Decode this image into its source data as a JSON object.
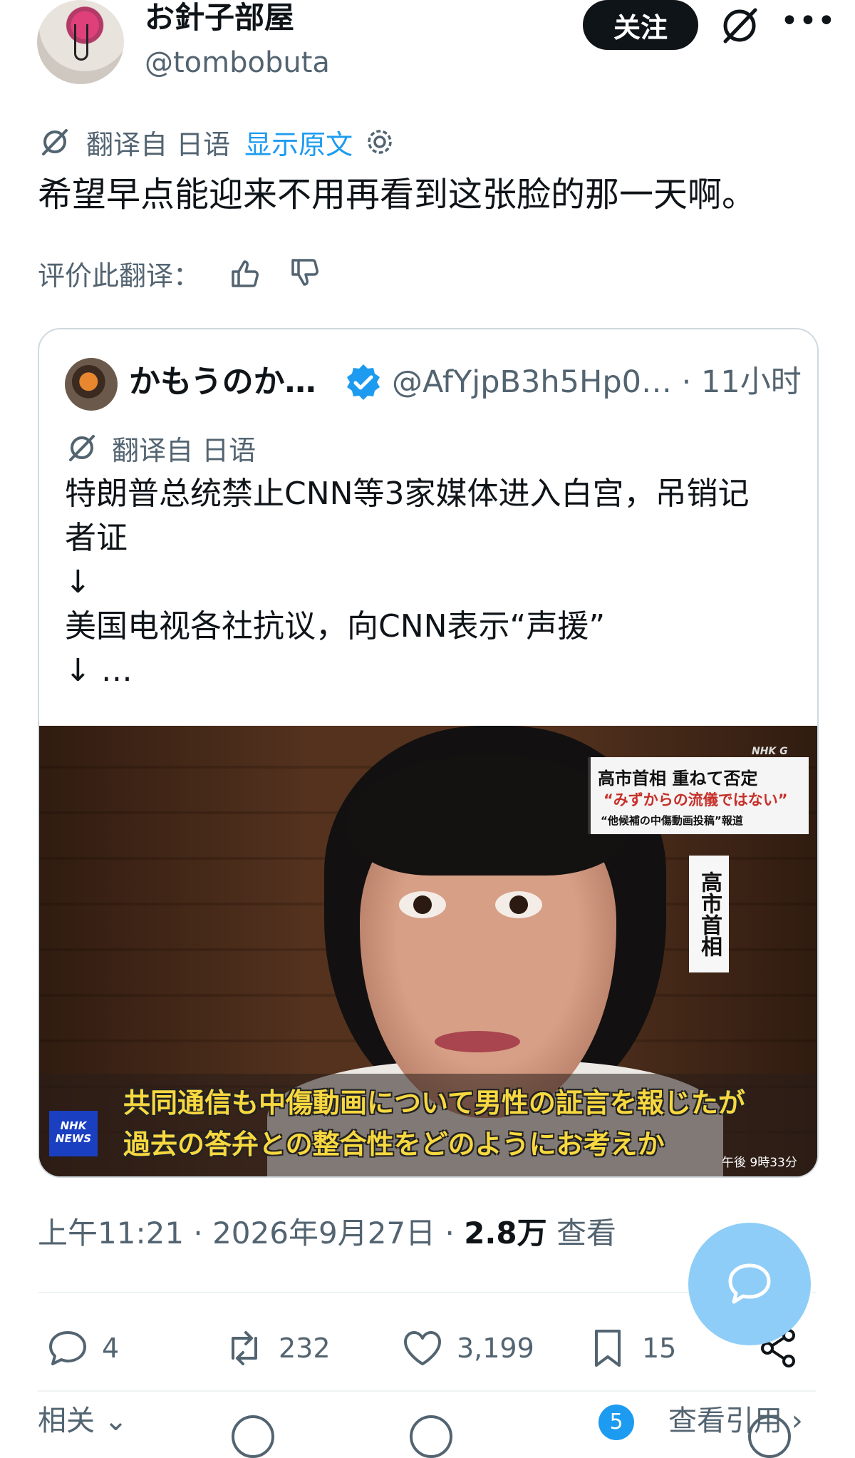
{
  "author": {
    "display_name": "お針子部屋",
    "handle": "@tombobuta",
    "follow_label": "关注"
  },
  "translation": {
    "translated_from": "翻译自 日语",
    "show_original": "显示原文"
  },
  "tweet": {
    "text": "希望早点能迎来不用再看到这张脸的那一天啊。"
  },
  "rate": {
    "label": "评价此翻译："
  },
  "quote": {
    "display_name": "かもうのか…",
    "handle_time": "@AfYjpB3h5Hp0… · 11小时",
    "translated_from": "翻译自 日语",
    "text": "特朗普总统禁止CNN等3家媒体进入白宫，吊销记\n者证\n↓\n美国电视各社抗议，向CNN表示“声援”\n↓ …",
    "image": {
      "channel_mark": "NHK G",
      "headline_line1": "高市首相 重ねて否定",
      "headline_line2": "“みずからの流儀ではない”",
      "headline_line3": "“他候補の中傷動画投稿”報道",
      "vertical_label": "高市首相",
      "caption_line1": "共同通信も中傷動画について男性の証言を報じたが",
      "caption_line2": "過去の答弁との整合性をどのようにお考えか",
      "logo_text_1": "NHK",
      "logo_text_2": "NEWS",
      "time": "午後 9時33分"
    }
  },
  "meta": {
    "time_date": "上午11:21 · 2026年9月27日 · ",
    "views_count": "2.8万",
    "views_label": " 查看"
  },
  "actions": {
    "replies": "4",
    "reposts": "232",
    "likes": "3,199",
    "bookmarks": "15"
  },
  "bottom": {
    "related_label": "相关",
    "see_quotes_label": "查看引用",
    "badge_count": "5"
  },
  "icons": {
    "grok": "grok-icon",
    "more": "more-icon",
    "gear": "gear-icon",
    "thumbs_up": "thumbs-up-icon",
    "thumbs_down": "thumbs-down-icon",
    "verified": "verified-badge-icon",
    "reply": "reply-icon",
    "repost": "repost-icon",
    "like": "like-icon",
    "bookmark": "bookmark-icon",
    "share": "share-icon",
    "compose_reply": "chat-bubble-icon",
    "chevron_down": "chevron-down-icon",
    "chevron_right": "chevron-right-icon"
  },
  "colors": {
    "link_blue": "#1d9bf0",
    "text_primary": "#0f1419",
    "text_secondary": "#536471",
    "fab_blue": "#8ecdf7"
  }
}
